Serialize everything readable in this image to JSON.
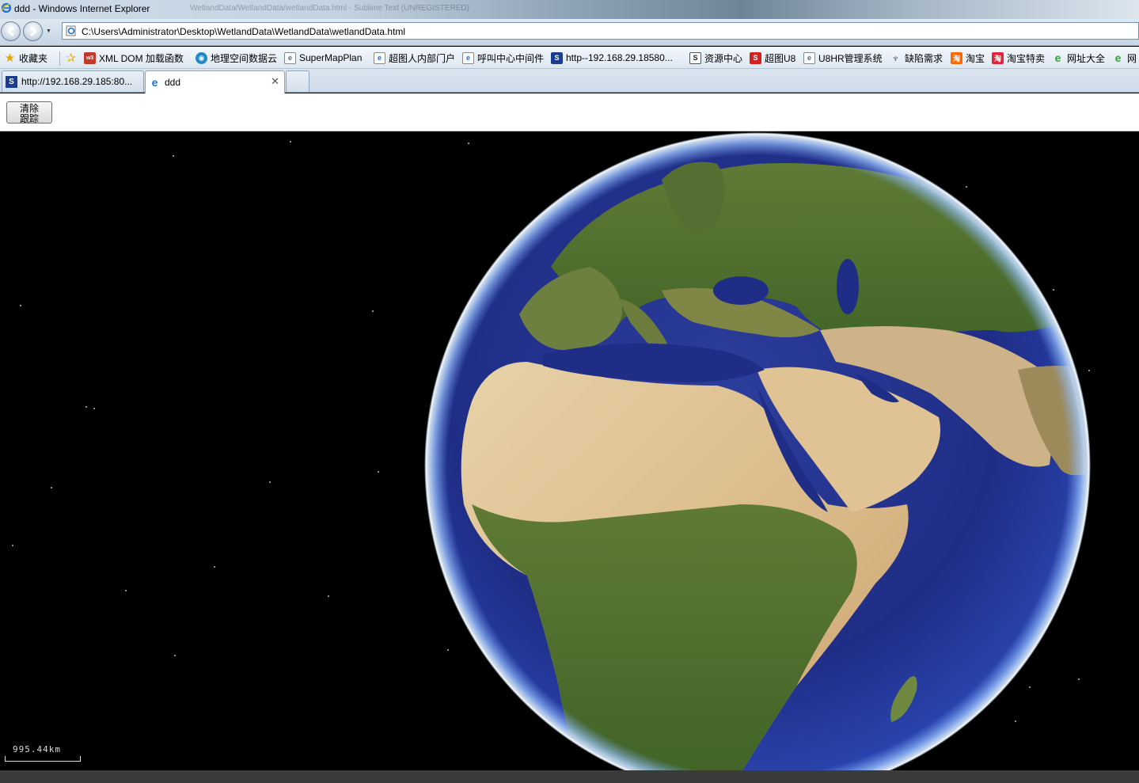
{
  "window": {
    "title": "ddd - Windows Internet Explorer",
    "ghost_text": "WetlandData/WetlandData/wetlandData.html - Sublime Text (UNREGISTERED)"
  },
  "address_bar": {
    "url": "C:\\Users\\Administrator\\Desktop\\WetlandData\\WetlandData\\wetlandData.html"
  },
  "favorites_bar": {
    "favorites_label": "收藏夹",
    "items": [
      {
        "label": "XML DOM 加载函数",
        "icon": "w3-icon"
      },
      {
        "label": "地理空间数据云",
        "icon": "globe-icon"
      },
      {
        "label": "SuperMapPlan",
        "icon": "ie-page-icon"
      },
      {
        "label": "超图人内部门户",
        "icon": "ie-page-icon"
      },
      {
        "label": "呼叫中心中间件",
        "icon": "ie-page-icon"
      },
      {
        "label": "http--192.168.29.18580...",
        "icon": "s-logo-icon"
      },
      {
        "label": "资源中心",
        "icon": "s-logo-icon"
      },
      {
        "label": "超图U8",
        "icon": "supermap-icon"
      },
      {
        "label": "U8HR管理系统",
        "icon": "ie-page-icon"
      },
      {
        "label": "缺陷需求",
        "icon": "figure-icon"
      },
      {
        "label": "淘宝",
        "icon": "taobao-icon"
      },
      {
        "label": "淘宝特卖",
        "icon": "taobao-icon"
      },
      {
        "label": "网址大全",
        "icon": "green-e-icon"
      },
      {
        "label": "网",
        "icon": "green-e-icon"
      }
    ]
  },
  "tabs": [
    {
      "label": "http://192.168.29.185:80...",
      "active": false
    },
    {
      "label": "ddd",
      "active": true
    }
  ],
  "page": {
    "clear_button_label": "清除跟踪"
  },
  "viewer": {
    "scale_label": "995.44km"
  },
  "colors": {
    "ocean": "#1c2a7a",
    "atmosphere": "#cfe6ff",
    "space": "#000000"
  }
}
